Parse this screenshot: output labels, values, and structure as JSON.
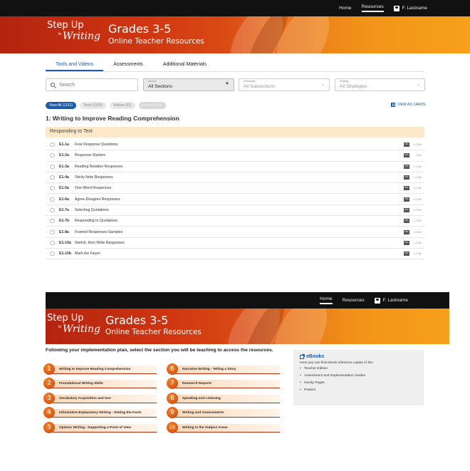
{
  "nav1": {
    "home": "Home",
    "resources": "Resources",
    "user": "F. Lastname"
  },
  "brand": {
    "step": "Step Up",
    "to": "to",
    "writing": "Writing",
    "title": "Grades 3-5",
    "subtitle": "Online Teacher Resources"
  },
  "tabs": [
    "Tools and Videos",
    "Assessments",
    "Additional Materials"
  ],
  "filters": {
    "search_placeholder": "Search",
    "section_label": "Section",
    "section_value": "All Sections",
    "subsection_label": "Subsection",
    "subsection_value": "All Subsections",
    "strategy_label": "Strategy",
    "strategy_value": "All Strategies"
  },
  "pills": [
    "View All (1131)",
    "Tools (1100)",
    "Videos (31)",
    "Favorites (0)"
  ],
  "view_as_cards": "VIEW AS CARDS",
  "section_title": "1: Writing to Improve Reading Comprehension",
  "subsection_title": "Responding to Text",
  "pdf_label": "PDF",
  "rows": [
    {
      "code": "E1-1a",
      "title": "Free Response Questions",
      "size": "4.2 Mb"
    },
    {
      "code": "E1-2a",
      "title": "Response Starters",
      "size": "3 Mb"
    },
    {
      "code": "E1-3a",
      "title": "Reading Notation Responses",
      "size": "4.2 Mb"
    },
    {
      "code": "E1-4a",
      "title": "Sticky Note Responses",
      "size": "4.2 Mb"
    },
    {
      "code": "E1-5a",
      "title": "One-Word Responses",
      "size": "4.2 Mb"
    },
    {
      "code": "E1-6a",
      "title": "Agree-Disagree Responses",
      "size": "4.2 Mb"
    },
    {
      "code": "E1-7a",
      "title": "Selecting Quotations",
      "size": "4.2 Mb"
    },
    {
      "code": "E1-7b",
      "title": "Responding to Quotations",
      "size": "4.2 Mb"
    },
    {
      "code": "E1-8a",
      "title": "Framed Responses-Samples",
      "size": "4.2 Mb"
    },
    {
      "code": "E1-10a",
      "title": "Sketch, then Write Responses",
      "size": "4.2 Mb"
    },
    {
      "code": "E1-10b",
      "title": "Mark the Faces",
      "size": "4.2 Mb"
    }
  ],
  "nav2": {
    "home": "Home",
    "resources": "Resources",
    "user": "F. Lastname"
  },
  "instructions": "Following your implementation plan, select the section you will be teaching to access the resources.",
  "sections": [
    {
      "num": "1",
      "label": "Writing to Improve Reading Comprehension"
    },
    {
      "num": "2",
      "label": "Foundational Writing Skills"
    },
    {
      "num": "3",
      "label": "Vocabulary Acquisition and Use"
    },
    {
      "num": "4",
      "label": "Informative-Explanatory Writing - Stating the Facts"
    },
    {
      "num": "5",
      "label": "Opinion Writing - Supporting a Point of View"
    },
    {
      "num": "6",
      "label": "Narrative Writing - Telling a Story"
    },
    {
      "num": "7",
      "label": "Research Reports"
    },
    {
      "num": "8",
      "label": "Speaking and Listening"
    },
    {
      "num": "9",
      "label": "Writing and Assessments"
    },
    {
      "num": "10",
      "label": "Writing in the Subject Areas"
    }
  ],
  "ebooks": {
    "title": "eBooks",
    "intro": "Here you can find ebook reference copies of the:",
    "items": [
      "Teacher Edition",
      "Assessment and Implementation Guides",
      "Handy Pages",
      "Posters"
    ]
  }
}
